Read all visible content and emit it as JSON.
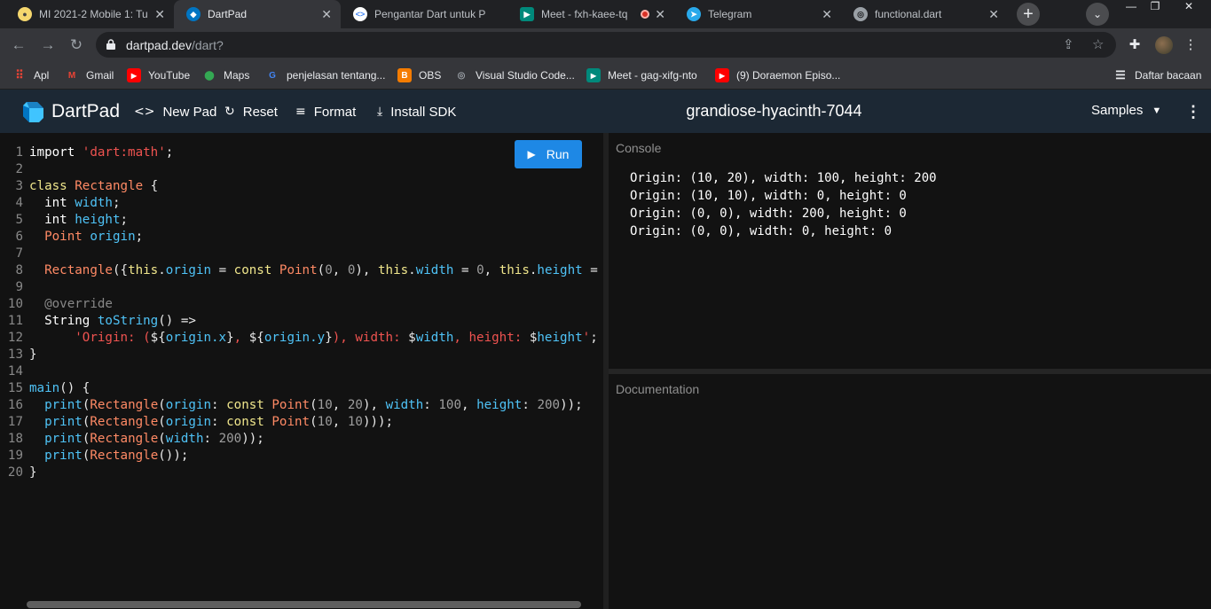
{
  "browser": {
    "tabs": [
      {
        "title": "MI 2021-2 Mobile 1: Tu",
        "icon": "moodle-icon"
      },
      {
        "title": "DartPad",
        "icon": "dart-icon"
      },
      {
        "title": "Pengantar Dart untuk P",
        "icon": "code-icon"
      },
      {
        "title": "Meet - fxh-kaee-tq",
        "icon": "meet-icon"
      },
      {
        "title": "Telegram",
        "icon": "telegram-icon"
      },
      {
        "title": "functional.dart",
        "icon": "globe-icon"
      }
    ],
    "url_host": "dartpad.dev",
    "url_path": "/dart?",
    "bookmarks": [
      {
        "label": "Apl"
      },
      {
        "label": "Gmail"
      },
      {
        "label": "YouTube"
      },
      {
        "label": "Maps"
      },
      {
        "label": "penjelasan tentang..."
      },
      {
        "label": "OBS"
      },
      {
        "label": "Visual Studio Code..."
      },
      {
        "label": "Meet - gag-xifg-nto"
      },
      {
        "label": "(9) Doraemon Episo..."
      }
    ],
    "reading_list": "Daftar bacaan"
  },
  "app": {
    "logo": "DartPad",
    "new_pad": "New Pad",
    "reset": "Reset",
    "format": "Format",
    "install_sdk": "Install SDK",
    "pad_name": "grandiose-hyacinth-7044",
    "samples": "Samples",
    "run": "Run",
    "console_title": "Console",
    "docs_title": "Documentation"
  },
  "console_output": [
    "Origin: (10, 20), width: 100, height: 200",
    "Origin: (10, 10), width: 0, height: 0",
    "Origin: (0, 0), width: 200, height: 0",
    "Origin: (0, 0), width: 0, height: 0"
  ],
  "line_numbers": [
    "1",
    "2",
    "3",
    "4",
    "5",
    "6",
    "7",
    "8",
    "9",
    "10",
    "11",
    "12",
    "13",
    "14",
    "15",
    "16",
    "17",
    "18",
    "19",
    "20"
  ],
  "colors": {
    "accent": "#1e88e5",
    "header_bg": "#1c2834",
    "editor_bg": "#121212"
  }
}
